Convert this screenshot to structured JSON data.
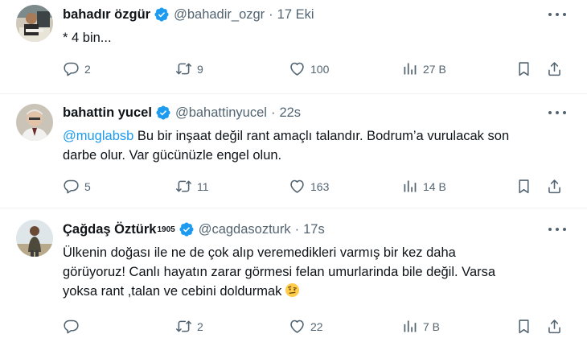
{
  "tweets": [
    {
      "name": "bahadır özgür",
      "handle": "@bahadir_ozgr",
      "time": "17 Eki",
      "text": "* 4 bin...",
      "replies": "2",
      "retweets": "9",
      "likes": "100",
      "views": "27 B"
    },
    {
      "name": "bahattin yucel",
      "handle": "@bahattinyucel",
      "time": "22s",
      "mention": "@muglabsb",
      "text_line1": " Bu bir inşaat değil rant amaçlı talandır. Bodrum’a vurulacak son",
      "text_line2": "darbe olur. Var gücünüzle engel olun.",
      "replies": "5",
      "retweets": "11",
      "likes": "163",
      "views": "14 B"
    },
    {
      "name": "Çağdaş Öztürk",
      "name_sup": "1905",
      "handle": "@cagdasozturk",
      "time": "17s",
      "text_line1": "Ülkenin doğası ile ne de çok alıp veremedikleri varmış bir kez daha",
      "text_line2": "görüyoruz! Canlı hayatın zarar görmesi felan umurlarinda bile değil. Varsa",
      "text_line3": "yoksa rant ,talan ve cebini doldurmak",
      "replies": "",
      "retweets": "2",
      "likes": "22",
      "views": "7 B"
    }
  ],
  "separator": "·",
  "icons": {
    "verified": "verified-badge-icon",
    "more": "more-icon",
    "reply": "reply-icon",
    "retweet": "retweet-icon",
    "like": "like-icon",
    "views": "views-icon",
    "bookmark": "bookmark-icon",
    "share": "share-icon",
    "emoji": "raised-eyebrow-emoji"
  },
  "colors": {
    "text": "#0f1419",
    "muted": "#536471",
    "accent": "#1d9bf0"
  }
}
